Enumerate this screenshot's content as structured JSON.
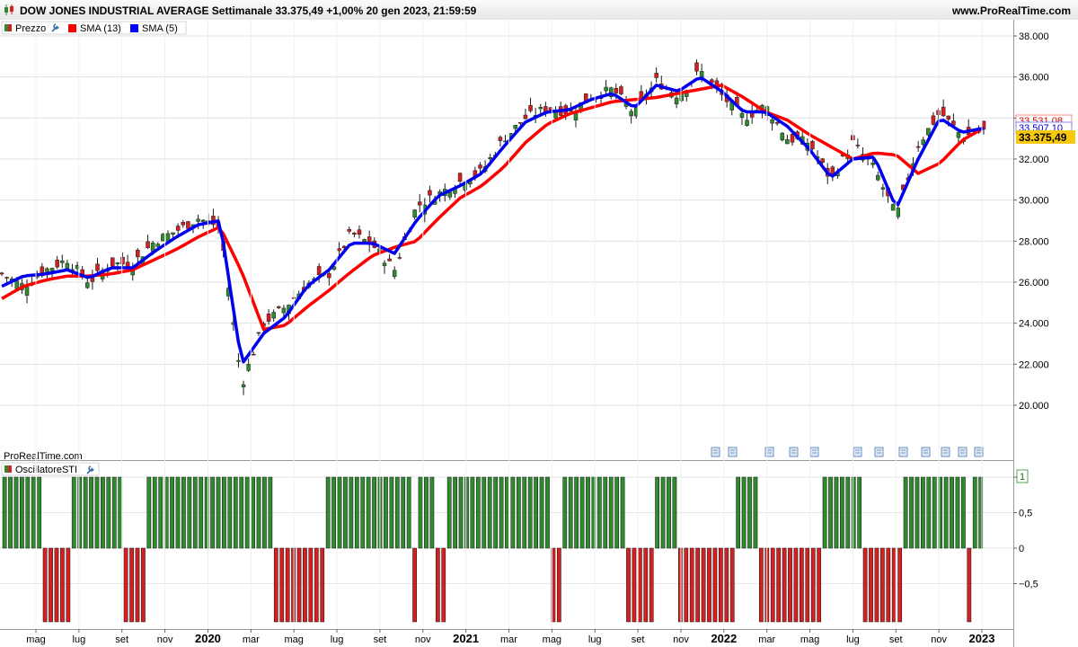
{
  "header": {
    "title": "DOW JONES INDUSTRIAL AVERAGE Settimanale 33.375,49 +1,00% 20 gen 2023, 21:59:59",
    "site": "www.ProRealTime.com"
  },
  "watermark": "ProRealTime.com",
  "legend": [
    {
      "label": "Prezzo",
      "color": "#2e8b2e"
    },
    {
      "label": "SMA (13)",
      "color": "#ff0000"
    },
    {
      "label": "SMA (5)",
      "color": "#0000ff"
    }
  ],
  "oscillator": {
    "label": "OscillatoreSTI",
    "axis_badge": "1"
  },
  "price_axis": {
    "ticks": [
      "38.000",
      "36.000",
      "34.000",
      "32.000",
      "30.000",
      "28.000",
      "26.000",
      "24.000",
      "22.000",
      "20.000"
    ],
    "badges": {
      "sma13": "33.531,08",
      "sma5": "33.507,10",
      "last": "33.375,49"
    }
  },
  "osc_axis": {
    "ticks": [
      "1",
      "0,5",
      "0",
      "−0,5"
    ]
  },
  "time_axis": {
    "labels": [
      "mag",
      "lug",
      "set",
      "nov",
      "2020",
      "mar",
      "mag",
      "lug",
      "set",
      "nov",
      "2021",
      "mar",
      "mag",
      "lug",
      "set",
      "nov",
      "2022",
      "mar",
      "mag",
      "lug",
      "set",
      "nov",
      "2023"
    ]
  },
  "chart_data": {
    "type": "line",
    "title": "DOW JONES INDUSTRIAL AVERAGE Settimanale",
    "x": [
      "2019-04",
      "2019-05",
      "2019-06",
      "2019-07",
      "2019-08",
      "2019-09",
      "2019-10",
      "2019-11",
      "2019-12",
      "2020-01",
      "2020-02",
      "2020-03",
      "2020-04",
      "2020-05",
      "2020-06",
      "2020-07",
      "2020-08",
      "2020-09",
      "2020-10",
      "2020-11",
      "2020-12",
      "2021-01",
      "2021-02",
      "2021-03",
      "2021-04",
      "2021-05",
      "2021-06",
      "2021-07",
      "2021-08",
      "2021-09",
      "2021-10",
      "2021-11",
      "2021-12",
      "2022-01",
      "2022-02",
      "2022-03",
      "2022-04",
      "2022-05",
      "2022-06",
      "2022-07",
      "2022-08",
      "2022-09",
      "2022-10",
      "2022-11",
      "2022-12",
      "2023-01"
    ],
    "series": [
      {
        "name": "Prezzo",
        "values": [
          26400,
          25800,
          26600,
          27100,
          26000,
          26900,
          26900,
          28000,
          28500,
          29100,
          28700,
          21000,
          24000,
          24800,
          25900,
          26400,
          28400,
          27800,
          26600,
          29700,
          30300,
          30900,
          31400,
          33000,
          34000,
          34500,
          34300,
          35000,
          35400,
          34200,
          35800,
          35100,
          36300,
          35100,
          34000,
          34600,
          33000,
          32800,
          31000,
          32800,
          31500,
          29200,
          32700,
          34300,
          33100,
          33375
        ]
      },
      {
        "name": "SMA (13)",
        "values": [
          25200,
          25800,
          26100,
          26300,
          26300,
          26400,
          26600,
          27100,
          27600,
          28200,
          28700,
          26500,
          23700,
          23900,
          24800,
          25600,
          26500,
          27300,
          27700,
          28000,
          29100,
          30100,
          30700,
          31600,
          32800,
          33700,
          34200,
          34500,
          34800,
          34900,
          35000,
          35200,
          35400,
          35600,
          35000,
          34300,
          33900,
          33200,
          32600,
          32000,
          32300,
          32200,
          31300,
          31800,
          32900,
          33531
        ]
      },
      {
        "name": "SMA (5)",
        "values": [
          25800,
          26300,
          26400,
          26600,
          26200,
          26700,
          26700,
          27500,
          28200,
          28800,
          29000,
          22000,
          23500,
          24300,
          25800,
          26600,
          27900,
          27900,
          27400,
          29000,
          30200,
          30700,
          31300,
          32600,
          33800,
          34300,
          34400,
          34900,
          35200,
          34500,
          35600,
          35300,
          36000,
          35300,
          34300,
          34300,
          33600,
          32500,
          31100,
          32000,
          32100,
          29600,
          32000,
          34000,
          33300,
          33507
        ]
      }
    ],
    "ylim": [
      18000,
      39000
    ],
    "oscillator": {
      "name": "OscillatoreSTI",
      "ylim": [
        -1,
        1
      ],
      "values": [
        1,
        1,
        1,
        1,
        1,
        1,
        1,
        -1,
        -1,
        -1,
        -1,
        -1,
        1,
        1,
        1,
        1,
        1,
        1,
        1,
        1,
        1,
        -1,
        -1,
        -1,
        -1,
        1,
        1,
        1,
        1,
        1,
        1,
        1,
        1,
        1,
        1,
        1,
        1,
        1,
        1,
        1,
        1,
        1,
        1,
        1,
        1,
        1,
        1,
        -1,
        -1,
        -1,
        -1,
        -1,
        -1,
        -1,
        -1,
        -1,
        1,
        1,
        1,
        1,
        1,
        1,
        1,
        1,
        1,
        1,
        1,
        1,
        1,
        1,
        1,
        -1,
        1,
        1,
        1,
        -1,
        -1,
        1,
        1,
        1,
        1,
        1,
        1,
        1,
        1,
        1,
        1,
        1,
        1,
        1,
        1,
        1,
        1,
        1,
        1,
        -1,
        -1,
        1,
        1,
        1,
        1,
        1,
        1,
        1,
        1,
        1,
        1,
        1,
        -1,
        -1,
        -1,
        -1,
        -1,
        1,
        1,
        1,
        1,
        -1,
        -1,
        -1,
        -1,
        -1,
        -1,
        -1,
        -1,
        -1,
        -1,
        1,
        1,
        1,
        1,
        -1,
        -1,
        -1,
        -1,
        -1,
        -1,
        -1,
        -1,
        -1,
        -1,
        -1,
        1,
        1,
        1,
        1,
        1,
        1,
        1,
        -1,
        -1,
        -1,
        -1,
        -1,
        -1,
        -1,
        1,
        1,
        1,
        1,
        1,
        1,
        1,
        1,
        1,
        1,
        1,
        -1,
        1,
        1
      ]
    }
  }
}
